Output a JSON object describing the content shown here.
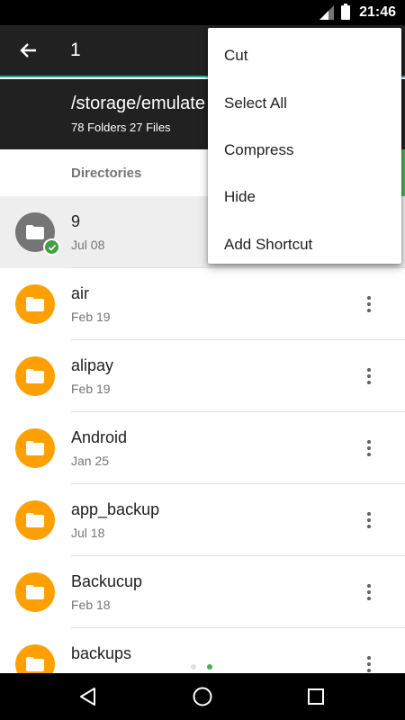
{
  "status_bar": {
    "time": "21:46",
    "icons": [
      "signal-icon",
      "battery-icon"
    ]
  },
  "toolbar": {
    "title": "1",
    "back_icon": "arrow-back-icon"
  },
  "pathbar": {
    "path": "/storage/emulate",
    "count": "78 Folders 27 Files"
  },
  "section": {
    "title": "Directories"
  },
  "rows": [
    {
      "name": "9",
      "date": "Jul 08",
      "selected": true
    },
    {
      "name": "air",
      "date": "Feb 19",
      "selected": false
    },
    {
      "name": "alipay",
      "date": "Feb 19",
      "selected": false
    },
    {
      "name": "Android",
      "date": "Jan 25",
      "selected": false
    },
    {
      "name": "app_backup",
      "date": "Jul 18",
      "selected": false
    },
    {
      "name": "Backucup",
      "date": "Feb 18",
      "selected": false
    },
    {
      "name": "backups",
      "date": "",
      "selected": false
    }
  ],
  "menu": {
    "items": [
      "Cut",
      "Select All",
      "Compress",
      "Hide",
      "Add Shortcut"
    ]
  },
  "nav_bar": {
    "icons": [
      "back-triangle-icon",
      "home-circle-icon",
      "recents-square-icon"
    ]
  },
  "colors": {
    "folder": "#ffa000",
    "accent": "#4caf50",
    "toolbar": "#212121",
    "selected_row": "#eeeeee"
  }
}
